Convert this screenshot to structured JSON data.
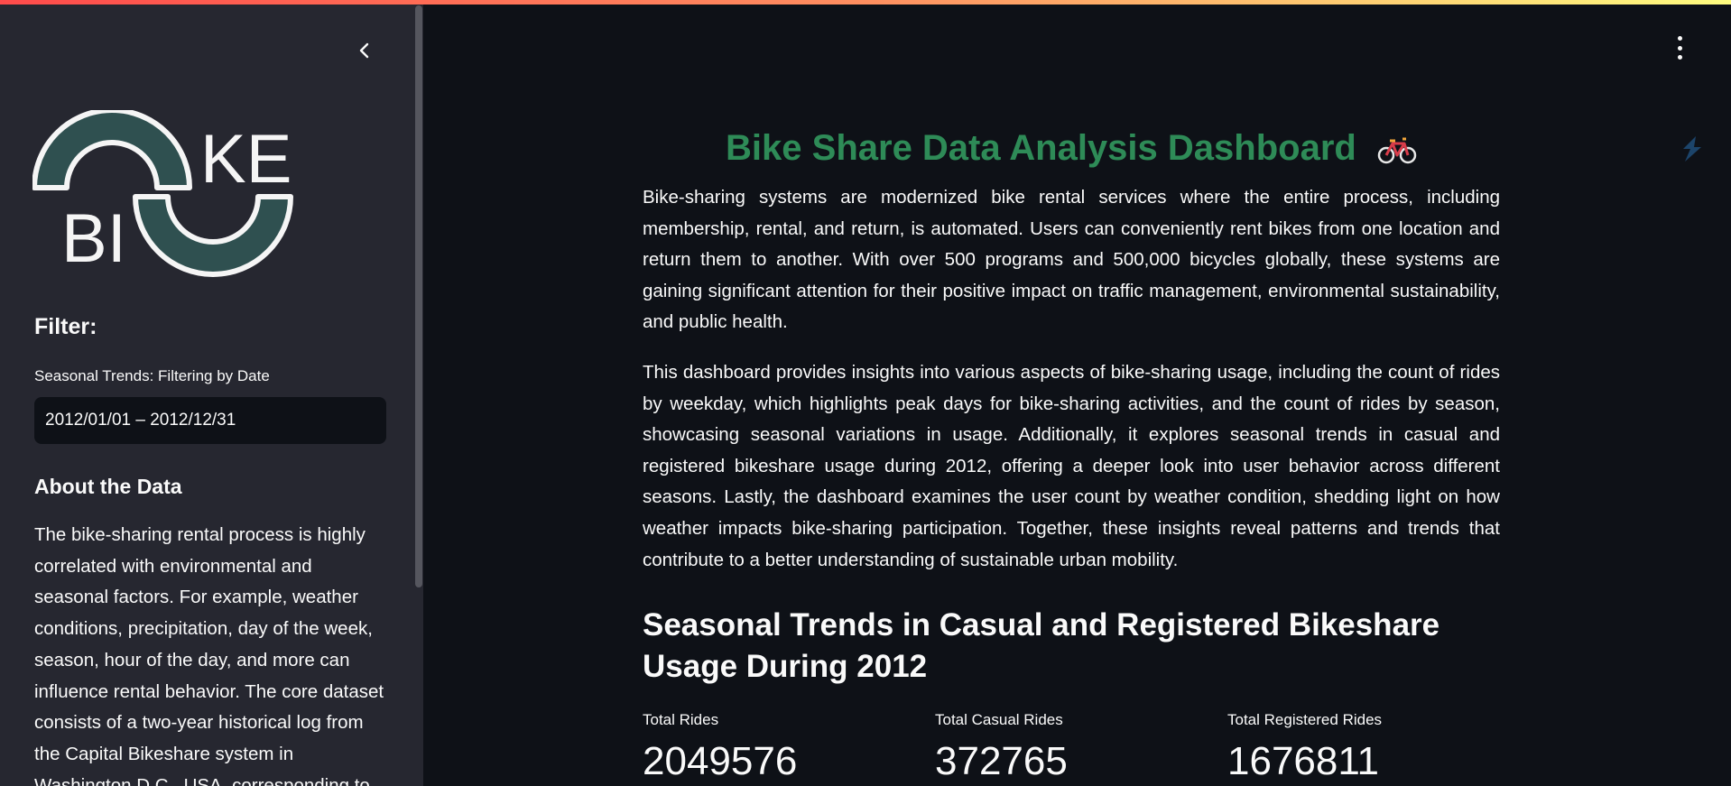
{
  "colors": {
    "background": "#0e1117",
    "sidebar": "#262730",
    "title": "#2e8b57",
    "logo_fill": "#2f5050",
    "logo_outline": "#f5f5f5"
  },
  "sidebar": {
    "collapse_icon": "chevron-left-icon",
    "logo_text": [
      "KE",
      "BI"
    ],
    "filter_heading": "Filter:",
    "date_label": "Seasonal Trends: Filtering by Date",
    "date_value": "2012/01/01 – 2012/12/31",
    "about_heading": "About the Data",
    "about_text": "The bike-sharing rental process is highly correlated with environmental and seasonal factors. For example, weather conditions, precipitation, day of the week, season, hour of the day, and more can influence rental behavior. The core dataset consists of a two-year historical log from the Capital Bikeshare system in Washington D.C., USA, corresponding to"
  },
  "header": {
    "menu_icon": "kebab-menu-icon"
  },
  "main": {
    "title": "Bike Share Data Analysis Dashboard",
    "title_icon": "bicycle-icon",
    "paragraph_1": "Bike-sharing systems are modernized bike rental services where the entire process, including membership, rental, and return, is automated. Users can conveniently rent bikes from one location and return them to another. With over 500 programs and 500,000 bicycles globally, these systems are gaining significant attention for their positive impact on traffic management, environmental sustainability, and public health.",
    "paragraph_2": "This dashboard provides insights into various aspects of bike-sharing usage, including the count of rides by weekday, which highlights peak days for bike-sharing activities, and the count of rides by season, showcasing seasonal variations in usage. Additionally, it explores seasonal trends in casual and registered bikeshare usage during 2012, offering a deeper look into user behavior across different seasons. Lastly, the dashboard examines the user count by weather condition, shedding light on how weather impacts bike-sharing participation. Together, these insights reveal patterns and trends that contribute to a better understanding of sustainable urban mobility.",
    "section_heading": "Seasonal Trends in Casual and Registered Bikeshare Usage During 2012",
    "metrics": [
      {
        "label": "Total Rides",
        "value": "2049576"
      },
      {
        "label": "Total Casual Rides",
        "value": "372765"
      },
      {
        "label": "Total Registered Rides",
        "value": "1676811"
      }
    ]
  }
}
